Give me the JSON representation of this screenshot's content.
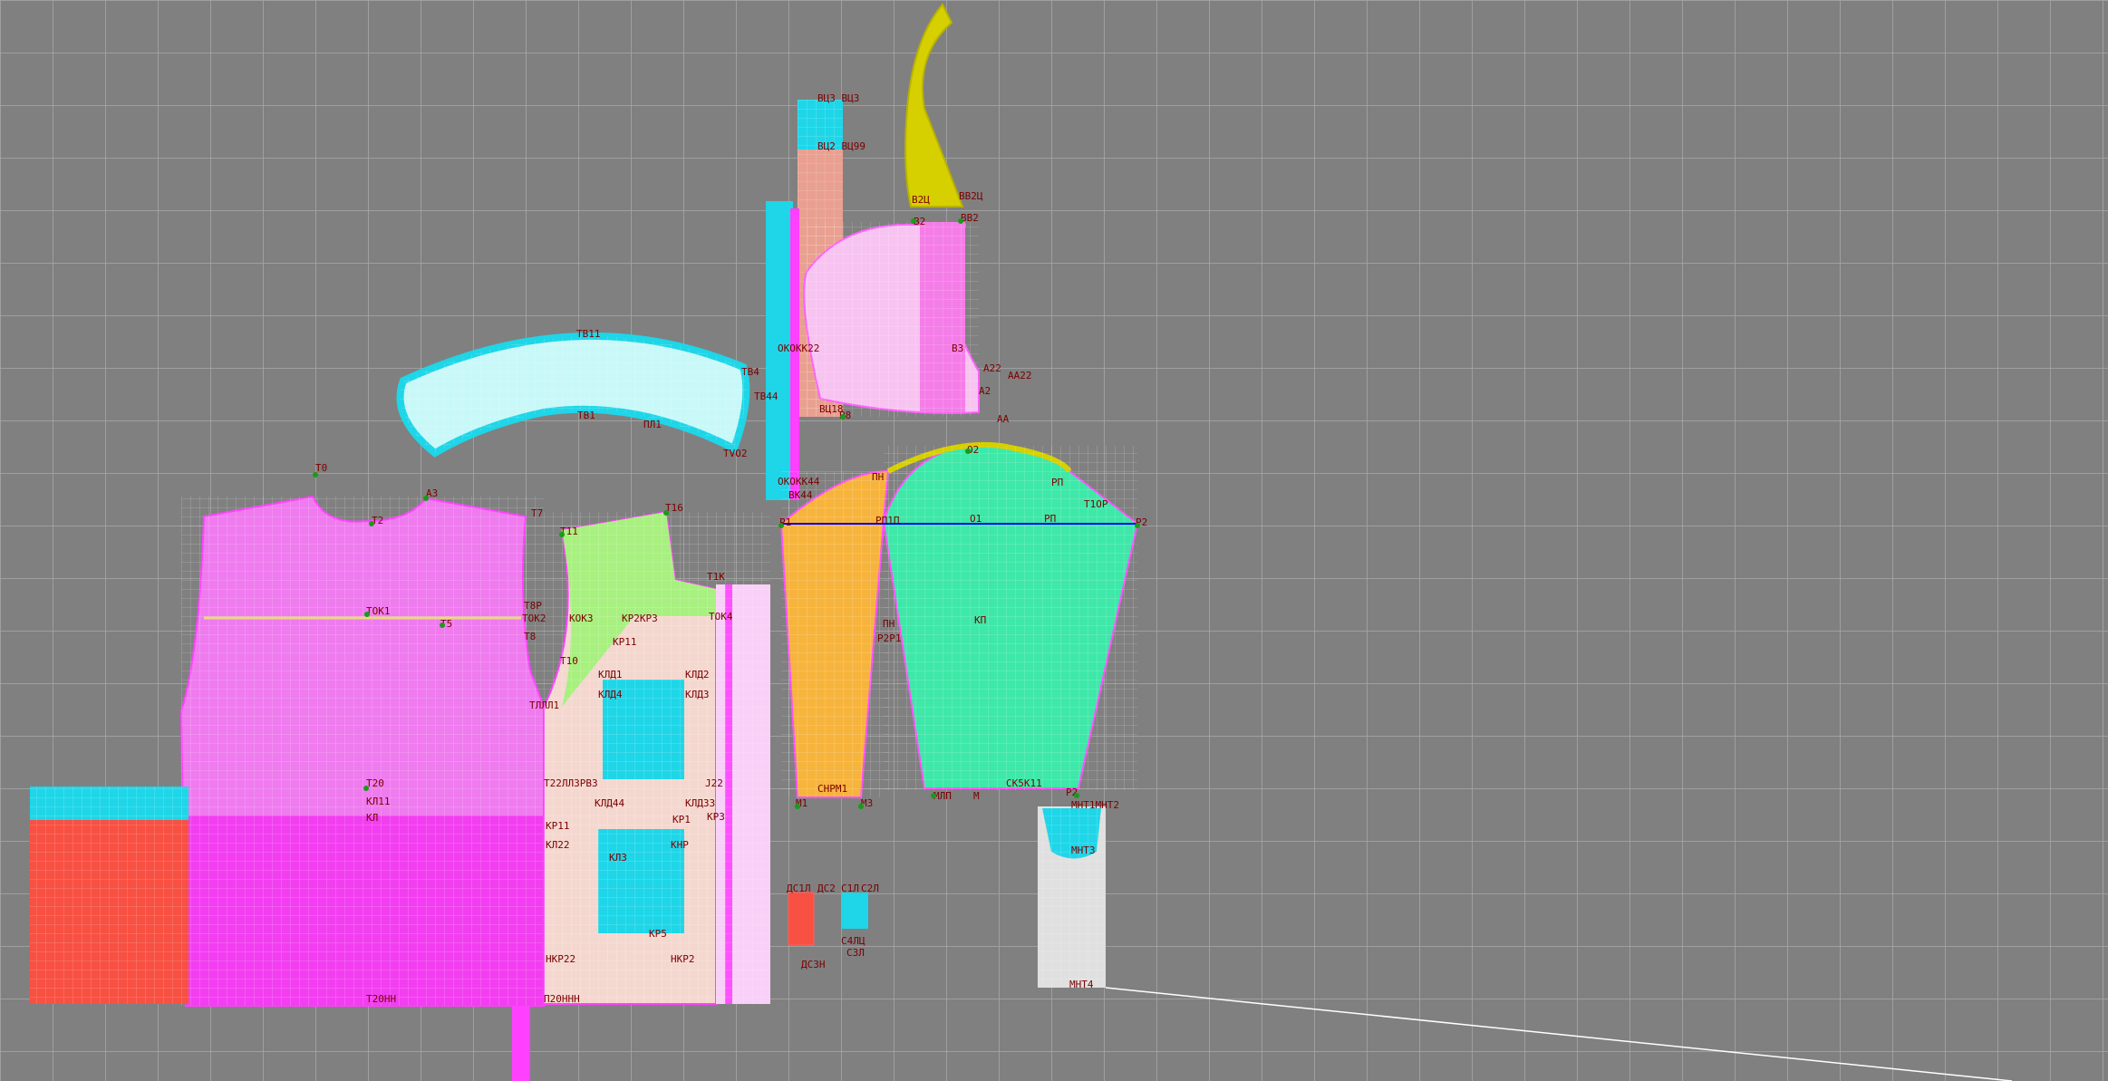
{
  "view": {
    "background": "#808080",
    "grid_color": "#a9a9a9"
  },
  "labels": {
    "vs3": "ВЦЗ ВЦЗ",
    "vs99": "ВЦ2 ВЦ99",
    "v2u": "В2Ц",
    "vv2u": "ВВ2Ц",
    "v2": "В2",
    "vv2": "ВВ2",
    "tv11": "ТВ11",
    "tv4": "ТВ4",
    "tv44": "ТВ44",
    "tv1": "ТВ1",
    "pl1": "ПЛ1",
    "tvo2": "ТVО2",
    "okk22": "ОКОКК22",
    "v3": "В3",
    "a22": "А22",
    "aa22": "АА22",
    "a2": "А2",
    "aa": "АА",
    "vu18": "ВЦ18",
    "b8": "В8",
    "okk44": "ОКОКК44",
    "bk44": "ВК44",
    "t0": "Т0",
    "a3": "А3",
    "t2": "Т2",
    "t7": "Т7",
    "t11": "Т11",
    "t16": "Т16",
    "pn": "ПН",
    "o2": "О2",
    "pp": "РП",
    "t1op": "Т1ОР",
    "p1": "Р1",
    "pp1": "РП1П",
    "o1": "О1",
    "rp": "РП",
    "p2": "Р2",
    "tok1": "ТОК1",
    "t5": "Т5",
    "t8p": "Т8Р",
    "tok2": "ТОК2",
    "t8": "Т8",
    "kok3": "КОК3",
    "krp3": "КР2КР3",
    "t1k": "Т1К",
    "tok4": "ТОК4",
    "kp": "КП",
    "pn2": "ПН",
    "rpp": "Р2Р1",
    "kp11": "КР11",
    "t10": "Т10",
    "kld1": "КЛД1",
    "kld2": "КЛД2",
    "kld4": "КЛД4",
    "kld3": "КЛД3",
    "t12": "ТЛЛЛ1",
    "t20": "Т20",
    "kl11": "КЛ11",
    "kl": "КЛ",
    "t22": "Т22ЛЛ3РВ3",
    "j22": "Ј22",
    "kld44": "КЛД44",
    "kld33": "КЛД33",
    "kp1": "КР1",
    "kr3": "КР3",
    "kn3": "КЛ3",
    "kp11b": "КР11",
    "kl22": "КЛ22",
    "knr": "КНР",
    "ml": "М1",
    "m3": "М3",
    "snm": "СНРМ1",
    "mlp": "МЛП",
    "m": "М",
    "sk11": "СК5К11",
    "r2": "Р2",
    "mu2": "МНТ1МНТ2",
    "mu3": "МНТ3",
    "mu4": "МНТ4",
    "mu4b": "МНТ3",
    "dsl": "ДС1Л",
    "dc2": "ДС2",
    "sl": "С1Л",
    "s2l": "С2Л",
    "pn3": "П20ННН",
    "kr22": "НКР22",
    "kp2": "НКР2",
    "kp5": "КР5",
    "t20h": "Т20НН",
    "dsn": "ДС3Н",
    "sp": "С4ЛЦ",
    "sp2": "С3Л"
  }
}
